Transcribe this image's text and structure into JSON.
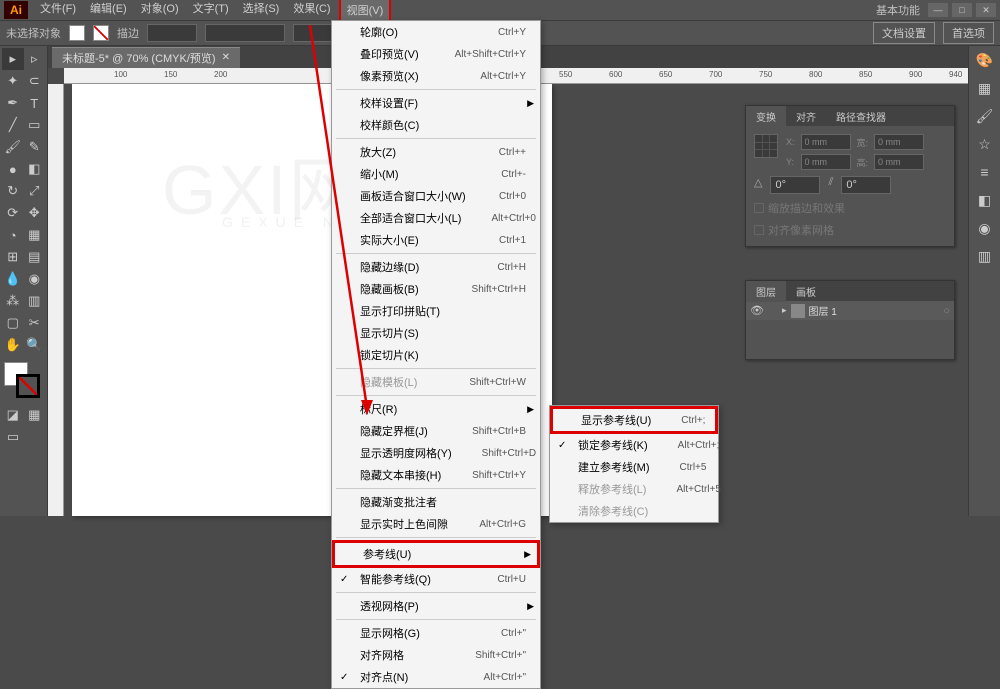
{
  "topbar": {
    "menus": [
      "文件(F)",
      "编辑(E)",
      "对象(O)",
      "文字(T)",
      "选择(S)",
      "效果(C)",
      "视图(V)"
    ],
    "right_label": "基本功能",
    "highlighted_index": 6
  },
  "controlbar": {
    "status": "未选择对象",
    "stroke_label": "描边",
    "opacity_label": "",
    "btn1": "文档设置",
    "btn2": "首选项"
  },
  "doc_tab": {
    "title": "未标题-5* @ 70% (CMYK/预览)"
  },
  "ruler_marks": [
    "100",
    "150",
    "200",
    "550",
    "600",
    "650",
    "700",
    "750",
    "800",
    "850",
    "900",
    "940"
  ],
  "view_menu": [
    {
      "label": "轮廓(O)",
      "shortcut": "Ctrl+Y"
    },
    {
      "label": "叠印预览(V)",
      "shortcut": "Alt+Shift+Ctrl+Y"
    },
    {
      "label": "像素预览(X)",
      "shortcut": "Alt+Ctrl+Y"
    },
    {
      "sep": true
    },
    {
      "label": "校样设置(F)",
      "arrow": true
    },
    {
      "label": "校样颜色(C)"
    },
    {
      "sep": true
    },
    {
      "label": "放大(Z)",
      "shortcut": "Ctrl++"
    },
    {
      "label": "缩小(M)",
      "shortcut": "Ctrl+-"
    },
    {
      "label": "画板适合窗口大小(W)",
      "shortcut": "Ctrl+0"
    },
    {
      "label": "全部适合窗口大小(L)",
      "shortcut": "Alt+Ctrl+0"
    },
    {
      "label": "实际大小(E)",
      "shortcut": "Ctrl+1"
    },
    {
      "sep": true
    },
    {
      "label": "隐藏边缘(D)",
      "shortcut": "Ctrl+H"
    },
    {
      "label": "隐藏画板(B)",
      "shortcut": "Shift+Ctrl+H"
    },
    {
      "label": "显示打印拼贴(T)"
    },
    {
      "label": "显示切片(S)"
    },
    {
      "label": "锁定切片(K)"
    },
    {
      "sep": true
    },
    {
      "label": "隐藏模板(L)",
      "shortcut": "Shift+Ctrl+W",
      "disabled": true
    },
    {
      "sep": true
    },
    {
      "label": "标尺(R)",
      "arrow": true
    },
    {
      "label": "隐藏定界框(J)",
      "shortcut": "Shift+Ctrl+B"
    },
    {
      "label": "显示透明度网格(Y)",
      "shortcut": "Shift+Ctrl+D"
    },
    {
      "label": "隐藏文本串接(H)",
      "shortcut": "Shift+Ctrl+Y"
    },
    {
      "sep": true
    },
    {
      "label": "隐藏渐变批注者"
    },
    {
      "label": "显示实时上色间隙",
      "shortcut": "Alt+Ctrl+G"
    },
    {
      "sep": true
    },
    {
      "label": "参考线(U)",
      "arrow": true,
      "boxed": true
    },
    {
      "label": "智能参考线(Q)",
      "shortcut": "Ctrl+U",
      "checked": true
    },
    {
      "sep": true
    },
    {
      "label": "透视网格(P)",
      "arrow": true
    },
    {
      "sep": true
    },
    {
      "label": "显示网格(G)",
      "shortcut": "Ctrl+\""
    },
    {
      "label": "对齐网格",
      "shortcut": "Shift+Ctrl+\""
    },
    {
      "label": "对齐点(N)",
      "shortcut": "Alt+Ctrl+\"",
      "checked": true
    }
  ],
  "sub_menu": [
    {
      "label": "显示参考线(U)",
      "shortcut": "Ctrl+;",
      "boxed": true
    },
    {
      "label": "锁定参考线(K)",
      "shortcut": "Alt+Ctrl+;",
      "checked": true
    },
    {
      "label": "建立参考线(M)",
      "shortcut": "Ctrl+5"
    },
    {
      "label": "释放参考线(L)",
      "shortcut": "Alt+Ctrl+5",
      "disabled": true
    },
    {
      "label": "清除参考线(C)",
      "disabled": true
    }
  ],
  "transform_panel": {
    "tabs": [
      "变换",
      "对齐",
      "路径查找器"
    ],
    "x": "0 mm",
    "y": "0 mm",
    "w": "0 mm",
    "h": "0 mm",
    "angle": "0°",
    "shear": "0°",
    "cb1": "缩放描边和效果",
    "cb2": "对齐像素网格"
  },
  "layers_panel": {
    "tabs": [
      "图层",
      "画板"
    ],
    "layer_name": "图层 1"
  },
  "watermark": {
    "main": "GXI网",
    "sub": "GEXUE NET"
  }
}
